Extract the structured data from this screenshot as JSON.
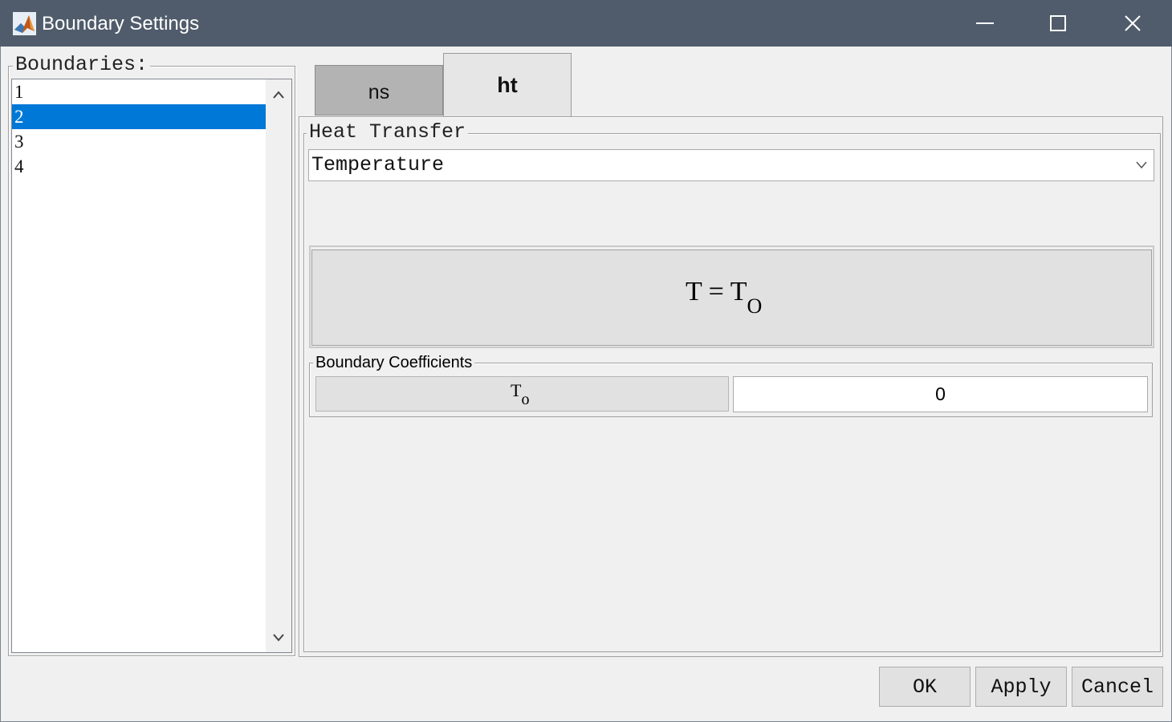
{
  "window": {
    "title": "Boundary Settings",
    "icon": "matlab-icon",
    "controls": [
      "minimize-icon",
      "maximize-icon",
      "close-icon"
    ]
  },
  "boundaries": {
    "label": "Boundaries:",
    "items": [
      "1",
      "2",
      "3",
      "4"
    ],
    "selected": "2"
  },
  "tabs": [
    {
      "label": "ns",
      "active": false
    },
    {
      "label": "ht",
      "active": true
    }
  ],
  "heat_transfer": {
    "label": "Heat Transfer",
    "condition": "Temperature",
    "equation": {
      "lhs": "T",
      "eq": "=",
      "rhs": "T",
      "rhs_sub": "O"
    }
  },
  "coefficients": {
    "label": "Boundary Coefficients",
    "name": "T",
    "name_sub": "o",
    "value": "0"
  },
  "buttons": {
    "ok": "OK",
    "apply": "Apply",
    "cancel": "Cancel"
  },
  "colors": {
    "titlebar": "#505c6b",
    "selection": "#0078d7"
  }
}
